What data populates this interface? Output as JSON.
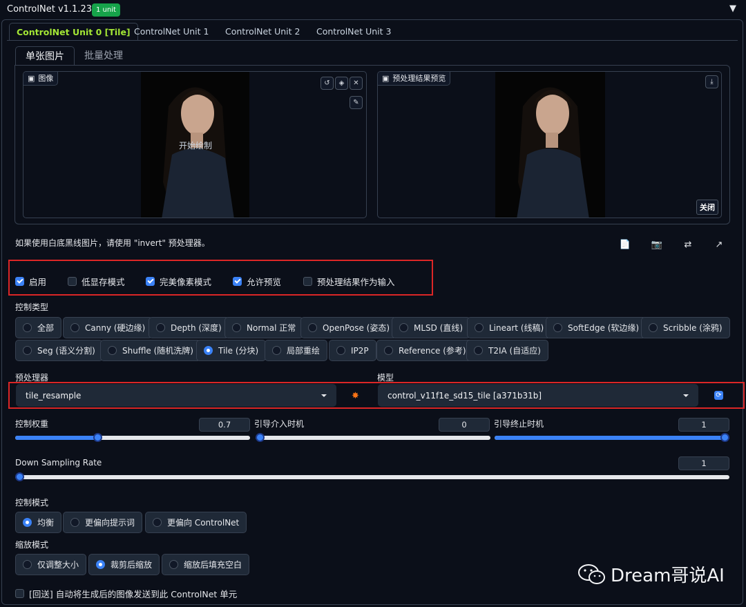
{
  "header": {
    "title": "ControlNet v1.1.238",
    "badge": "1 unit",
    "collapse_icon": "triangle-down-icon"
  },
  "unit_tabs": [
    "ControlNet Unit 0 [Tile]",
    "ControlNet Unit 1",
    "ControlNet Unit 2",
    "ControlNet Unit 3"
  ],
  "mode_tabs": [
    "单张图片",
    "批量处理"
  ],
  "image_panel": {
    "label": "图像",
    "draw_hint": "开始绘制",
    "tool_icons": [
      "undo-icon",
      "eraser-icon",
      "close-icon",
      "brush-icon"
    ]
  },
  "preview_panel": {
    "label": "预处理结果预览",
    "download_icon": "download-icon",
    "close_label": "关闭"
  },
  "invert_note": "如果使用白底黑线图片，请使用 \"invert\" 预处理器。",
  "toolbar_icons": [
    "new-canvas-icon",
    "camera-icon",
    "swap-icon",
    "send-dimensions-icon"
  ],
  "options": [
    {
      "label": "启用",
      "checked": true
    },
    {
      "label": "低显存模式",
      "checked": false
    },
    {
      "label": "完美像素模式",
      "checked": true
    },
    {
      "label": "允许预览",
      "checked": true
    },
    {
      "label": "预处理结果作为输入",
      "checked": false
    }
  ],
  "control_type": {
    "label": "控制类型",
    "options": [
      "全部",
      "Canny (硬边缘)",
      "Depth (深度)",
      "Normal 正常",
      "OpenPose (姿态)",
      "MLSD (直线)",
      "Lineart (线稿)",
      "SoftEdge (软边缘)",
      "Scribble (涂鸦)",
      "Seg (语义分割)",
      "Shuffle (随机洗牌)",
      "Tile (分块)",
      "局部重绘",
      "IP2P",
      "Reference (参考)",
      "T2IA (自适应)"
    ],
    "selected": "Tile (分块)"
  },
  "preprocessor": {
    "label": "预处理器",
    "value": "tile_resample",
    "run_icon": "explosion-icon"
  },
  "model": {
    "label": "模型",
    "value": "control_v11f1e_sd15_tile [a371b31b]",
    "refresh_icon": "refresh-icon"
  },
  "sliders": [
    {
      "label": "控制权重",
      "value": "0.7",
      "min": 0,
      "max": 2,
      "fraction": 0.35
    },
    {
      "label": "引导介入时机",
      "value": "0",
      "min": 0,
      "max": 1,
      "fraction": 0.0
    },
    {
      "label": "引导终止时机",
      "value": "1",
      "min": 0,
      "max": 1,
      "fraction": 1.0
    }
  ],
  "downsampling": {
    "label": "Down Sampling Rate",
    "value": "1",
    "fraction": 0.0
  },
  "control_mode": {
    "label": "控制模式",
    "options": [
      "均衡",
      "更偏向提示词",
      "更偏向 ControlNet"
    ],
    "selected": "均衡"
  },
  "resize_mode": {
    "label": "缩放模式",
    "options": [
      "仅调整大小",
      "裁剪后缩放",
      "缩放后填充空白"
    ],
    "selected": "裁剪后缩放"
  },
  "loopback": {
    "label": "[回送] 自动将生成后的图像发送到此 ControlNet 单元",
    "checked": false
  },
  "watermark": {
    "text": "Dream哥说AI",
    "icon": "wechat-icon"
  },
  "colors": {
    "accent": "#3b82f6",
    "active_tab": "#a3e635",
    "badge": "#16a34a",
    "highlight": "#dc2626"
  }
}
